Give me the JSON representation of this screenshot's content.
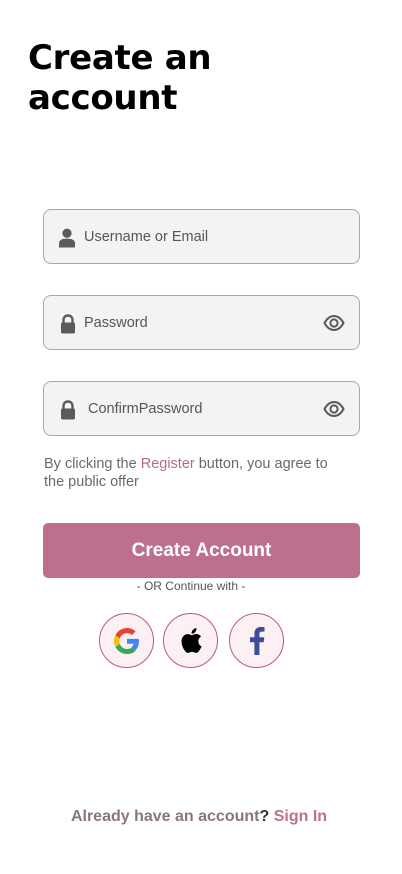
{
  "page": {
    "title": "Create an\naccount"
  },
  "form": {
    "username": {
      "placeholder": "Username or Email",
      "value": ""
    },
    "password": {
      "placeholder": "Password",
      "value": ""
    },
    "confirm_password": {
      "placeholder": "ConfirmPassword",
      "value": ""
    }
  },
  "terms": {
    "prefix": "By clicking the ",
    "link": "Register",
    "suffix": " button, you agree to the public offer"
  },
  "submit_label": "Create Account",
  "divider": "- OR Continue with -",
  "social": [
    {
      "name": "google",
      "icon": "google-icon"
    },
    {
      "name": "apple",
      "icon": "apple-icon"
    },
    {
      "name": "facebook",
      "icon": "facebook-icon"
    }
  ],
  "footer": {
    "prompt": "Already have an account",
    "question_mark": "?",
    "link": "Sign In"
  },
  "colors": {
    "accent": "#bd6f8e",
    "field_bg": "#f3f3f3",
    "field_border": "#a8a8a8",
    "social_border": "#c5557e"
  }
}
